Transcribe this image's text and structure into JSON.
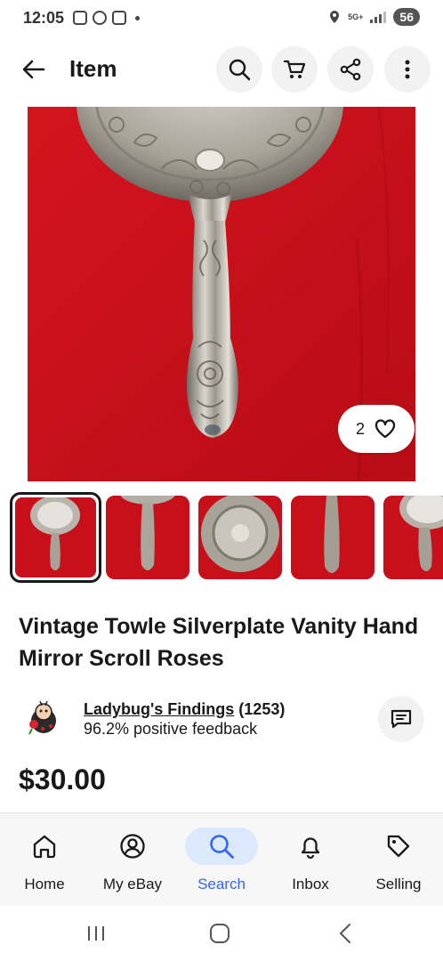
{
  "status_bar": {
    "time": "12:05",
    "network": "5G+",
    "battery": "56"
  },
  "header": {
    "title": "Item",
    "icons": [
      "back-arrow-icon",
      "search-icon",
      "cart-icon",
      "share-icon",
      "more-vert-icon"
    ]
  },
  "gallery": {
    "like_count": "2",
    "thumbnails": [
      "mirror-full",
      "handle",
      "back-ornate",
      "handle-closeup",
      "mirror-angle"
    ],
    "selected_index": 0
  },
  "item": {
    "title": "Vintage Towle Silverplate Vanity Hand Mirror Scroll Roses",
    "price": "$30.00"
  },
  "seller": {
    "name": "Ladybug's Findings",
    "feedback_count": "(1253)",
    "feedback": "96.2% positive feedback"
  },
  "bottom_nav": {
    "items": [
      {
        "label": "Home",
        "icon": "home-icon"
      },
      {
        "label": "My eBay",
        "icon": "person-icon"
      },
      {
        "label": "Search",
        "icon": "search-icon"
      },
      {
        "label": "Inbox",
        "icon": "bell-icon"
      },
      {
        "label": "Selling",
        "icon": "tag-icon"
      }
    ],
    "active": "Search"
  },
  "colors": {
    "accent": "#3665f3",
    "active_pill": "#dce8fb",
    "product_background": "#c8101a",
    "text": "#191919"
  }
}
